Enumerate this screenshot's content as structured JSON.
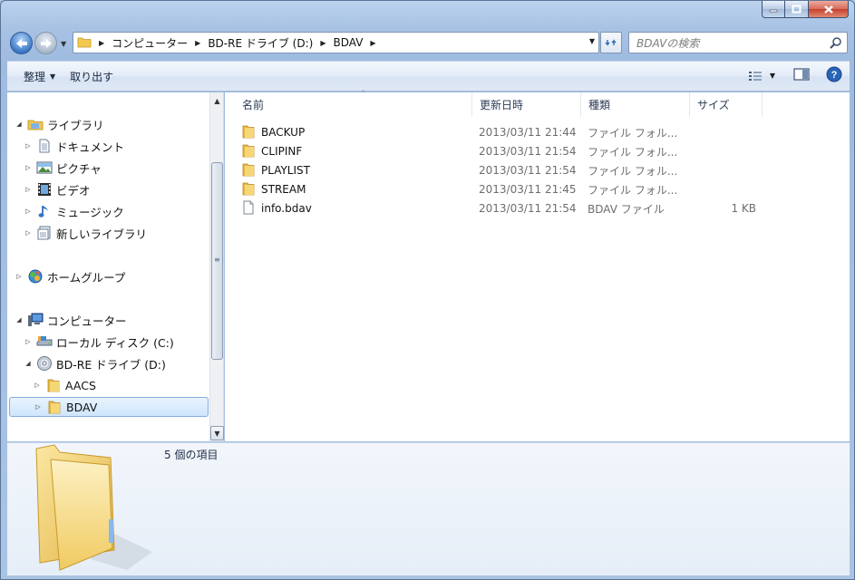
{
  "window": {
    "controls": [
      "minimize",
      "maximize",
      "close"
    ]
  },
  "address": {
    "crumbs": [
      "コンピューター",
      "BD-RE ドライブ (D:)",
      "BDAV"
    ]
  },
  "search": {
    "placeholder": "BDAVの検索"
  },
  "toolbar": {
    "organize_label": "整理",
    "eject_label": "取り出す"
  },
  "nav_tree": [
    {
      "label": "ライブラリ",
      "icon": "library-icon",
      "expanded": true
    },
    {
      "label": "ドキュメント",
      "icon": "document-icon"
    },
    {
      "label": "ピクチャ",
      "icon": "picture-icon"
    },
    {
      "label": "ビデオ",
      "icon": "video-icon"
    },
    {
      "label": "ミュージック",
      "icon": "music-icon"
    },
    {
      "label": "新しいライブラリ",
      "icon": "new-library-icon"
    },
    {
      "label": "ホームグループ",
      "icon": "homegroup-icon"
    },
    {
      "label": "コンピューター",
      "icon": "computer-icon",
      "expanded": true
    },
    {
      "label": "ローカル ディスク (C:)",
      "icon": "local-disk-icon"
    },
    {
      "label": "BD-RE ドライブ (D:)",
      "icon": "bd-drive-icon",
      "expanded": true
    },
    {
      "label": "AACS",
      "icon": "folder-icon"
    },
    {
      "label": "BDAV",
      "icon": "folder-icon",
      "selected": true
    }
  ],
  "columns": {
    "name": "名前",
    "date": "更新日時",
    "type": "種類",
    "size": "サイズ"
  },
  "files": [
    {
      "name": "BACKUP",
      "date": "2013/03/11 21:44",
      "type": "ファイル フォル...",
      "size": "",
      "icon": "folder-icon"
    },
    {
      "name": "CLIPINF",
      "date": "2013/03/11 21:54",
      "type": "ファイル フォル...",
      "size": "",
      "icon": "folder-icon"
    },
    {
      "name": "PLAYLIST",
      "date": "2013/03/11 21:54",
      "type": "ファイル フォル...",
      "size": "",
      "icon": "folder-icon"
    },
    {
      "name": "STREAM",
      "date": "2013/03/11 21:45",
      "type": "ファイル フォル...",
      "size": "",
      "icon": "folder-icon"
    },
    {
      "name": "info.bdav",
      "date": "2013/03/11 21:54",
      "type": "BDAV ファイル",
      "size": "1 KB",
      "icon": "file-icon"
    }
  ],
  "details": {
    "count_text": "5 個の項目"
  },
  "colors": {
    "frame": "#a9c4e3",
    "selection": "#cfe6fc",
    "folder": "#f2c94c"
  }
}
